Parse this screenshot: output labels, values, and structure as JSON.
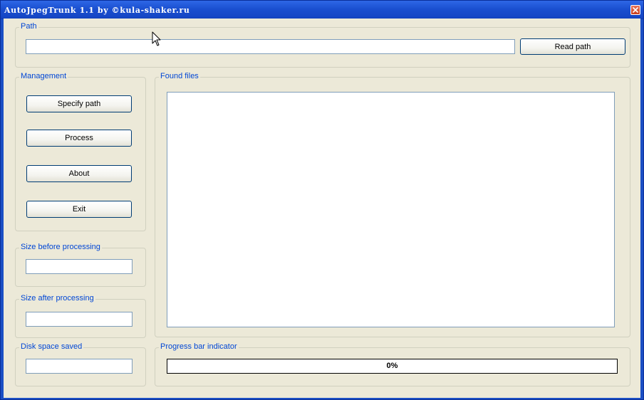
{
  "window": {
    "title": "AutoJpegTrunk 1.1 by ©kula-shaker.ru"
  },
  "path_group": {
    "legend": "Path",
    "input_value": "",
    "read_button": "Read path"
  },
  "management": {
    "legend": "Management",
    "buttons": [
      "Specify path",
      "Process",
      "About",
      "Exit"
    ]
  },
  "found_files": {
    "legend": "Found files",
    "items": []
  },
  "size_before": {
    "legend": "Size before processing",
    "value": ""
  },
  "size_after": {
    "legend": "Size after processing",
    "value": ""
  },
  "disk_saved": {
    "legend": "Disk space saved",
    "value": ""
  },
  "progress": {
    "legend": "Progress bar indicator",
    "label": "0%",
    "fraction": 0
  },
  "icons": {
    "close": "close-icon",
    "cursor": "mouse-cursor-icon"
  },
  "colors": {
    "titlebar": "#1b4fc4",
    "window_bg": "#ece9d8",
    "group_label": "#0046d5"
  }
}
